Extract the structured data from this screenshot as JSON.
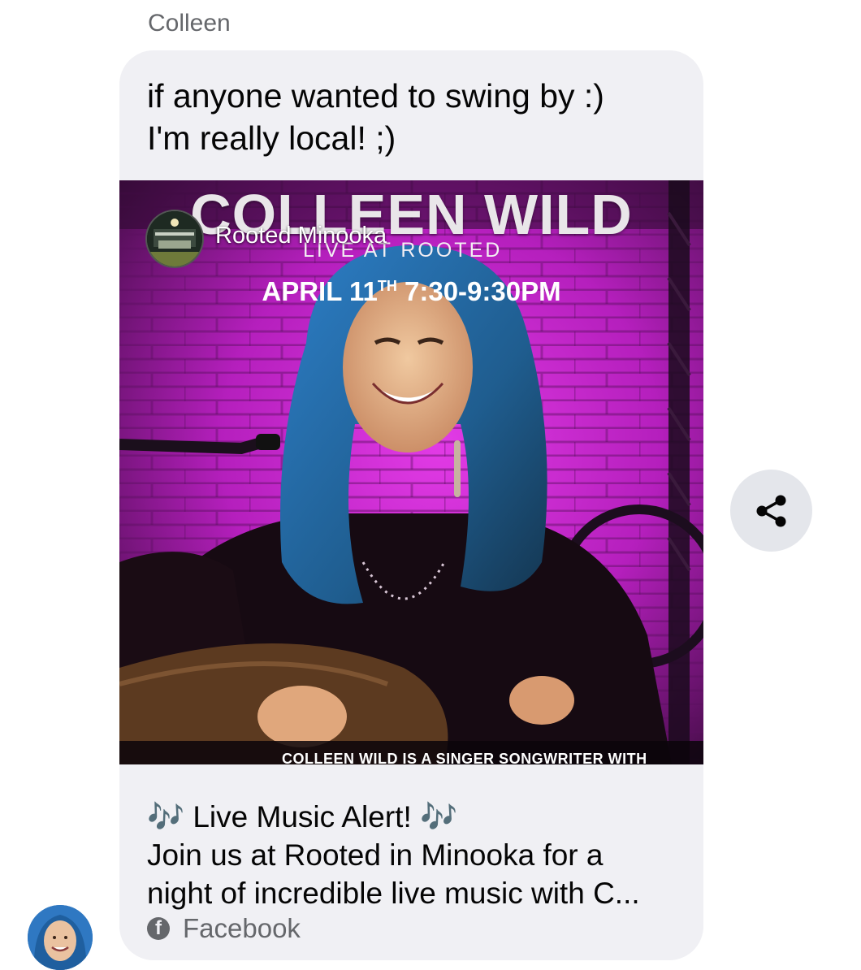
{
  "conversation": {
    "sender_name": "Colleen",
    "message_lines": [
      "if anyone wanted to swing by :)",
      "I'm really local! ;)"
    ]
  },
  "shared_post": {
    "poster": {
      "title": "COLLEEN WILD",
      "subtitle": "LIVE AT ROOTED",
      "page_name": "Rooted Minooka",
      "date_prefix": "APRIL 11",
      "date_suffix": "TH",
      "time": " 7:30-9:30PM",
      "caption_strip": "COLLEEN WILD IS A SINGER SONGWRITER WITH"
    },
    "caption_lines": [
      "🎶 Live Music Alert! 🎶",
      "Join us at Rooted in Minooka for a",
      "night of incredible live music with C..."
    ],
    "source_label": "Facebook",
    "source_icon": "facebook-icon"
  },
  "actions": {
    "share_icon": "share-icon"
  },
  "colors": {
    "bubble": "#f0f0f4",
    "secondary_text": "#65676b",
    "share_button_bg": "#e4e6eb",
    "poster_magenta": "#c21fc8"
  }
}
